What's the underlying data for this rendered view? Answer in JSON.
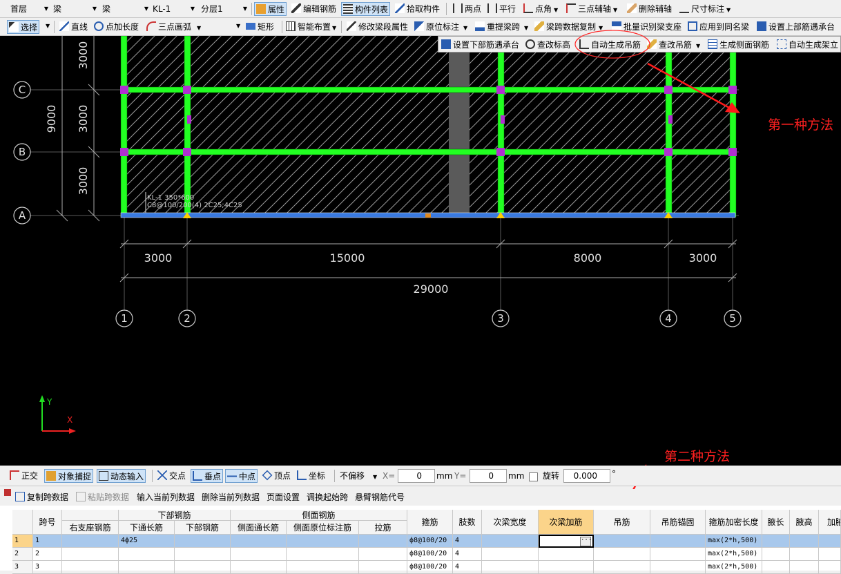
{
  "toolbar1": {
    "floor": "首层",
    "type1": "梁",
    "type2": "梁",
    "member": "KL-1",
    "layer": "分层1",
    "properties": "属性",
    "edit_rebar": "编辑钢筋",
    "member_list": "构件列表",
    "pick_member": "拾取构件",
    "two_point": "两点",
    "parallel": "平行",
    "point_angle": "点角",
    "three_point_axis": "三点辅轴",
    "delete_axis": "删除辅轴",
    "dimension": "尺寸标注"
  },
  "toolbar2": {
    "select": "选择",
    "line": "直线",
    "point_length": "点加长度",
    "arc": "三点画弧",
    "rect": "矩形",
    "smart_layout": "智能布置",
    "modify_span": "修改梁段属性",
    "origin_mark": "原位标注",
    "reextract_span": "重提梁跨",
    "copy_span_data": "梁跨数据复制",
    "batch_identify": "批量识别梁支座",
    "apply_same_name": "应用到同名梁",
    "set_top_rebar": "设置上部筋遇承台"
  },
  "popup": {
    "set_bottom_rebar": "设置下部筋遇承台",
    "check_elevation": "查改标高",
    "auto_hanger": "自动生成吊筋",
    "check_hanger": "查改吊筋",
    "gen_side_rebar": "生成侧面钢筋",
    "auto_stand_rebar": "自动生成架立筋"
  },
  "annotations": {
    "method1": "第一种方法",
    "method2": "第二种方法"
  },
  "drawing": {
    "row_axes": [
      "C",
      "B",
      "A"
    ],
    "col_axes": [
      "1",
      "2",
      "3",
      "4",
      "5"
    ],
    "v_dims": [
      "3000",
      "3000",
      "3000"
    ],
    "v_total": "9000",
    "h_dims": [
      "3000",
      "15000",
      "8000",
      "3000"
    ],
    "h_total": "29000",
    "beam_label_1": "KL-1 350*600",
    "beam_label_2": "C8@100/200(4) 2C25;4C25",
    "ucs_y": "Y",
    "ucs_x": "X"
  },
  "snapbar": {
    "ortho": "正交",
    "object_snap": "对象捕捉",
    "dynamic_input": "动态输入",
    "intersection": "交点",
    "perpendicular": "垂点",
    "midpoint": "中点",
    "vertex": "顶点",
    "coordinate": "坐标",
    "offset": "不偏移",
    "x_label": "X=",
    "x_value": "0",
    "y_label": "Y=",
    "y_value": "0",
    "unit": "mm",
    "rotate": "旋转",
    "rotate_value": "0.000",
    "degree": "°"
  },
  "gridbar": {
    "copy_span": "复制跨数据",
    "paste_span": "粘贴跨数据",
    "input_col": "输入当前列数据",
    "delete_col": "删除当前列数据",
    "page_setup": "页面设置",
    "swap_start": "调换起始跨",
    "cantilever": "悬臂钢筋代号"
  },
  "grid": {
    "h_span": "跨号",
    "h_bottom": "下部钢筋",
    "h_side": "侧面钢筋",
    "h_right_support": "右支座钢筋",
    "h_bottom_through": "下通长筋",
    "h_bottom_rebar": "下部钢筋",
    "h_side_through": "侧面通长筋",
    "h_side_origin": "侧面原位标注筋",
    "h_tie": "拉筋",
    "h_stirrup": "箍筋",
    "h_legs": "肢数",
    "h_sec_width": "次梁宽度",
    "h_sec_add": "次梁加筋",
    "h_hanger": "吊筋",
    "h_hanger_anchor": "吊筋锚固",
    "h_dense_len": "箍筋加密长度",
    "h_haunch_len": "腋长",
    "h_haunch_h": "腋高",
    "h_extra": "加腋",
    "rows": [
      {
        "idx": "1",
        "span": "1",
        "bottom_through": "4ф25",
        "stirrup": "ф8@100/20",
        "legs": "4",
        "dense": "max(2*h,500)"
      },
      {
        "idx": "2",
        "span": "2",
        "bottom_through": "",
        "stirrup": "ф8@100/20",
        "legs": "4",
        "dense": "max(2*h,500)"
      },
      {
        "idx": "3",
        "span": "3",
        "bottom_through": "",
        "stirrup": "ф8@100/20",
        "legs": "4",
        "dense": "max(2*h,500)"
      }
    ]
  }
}
